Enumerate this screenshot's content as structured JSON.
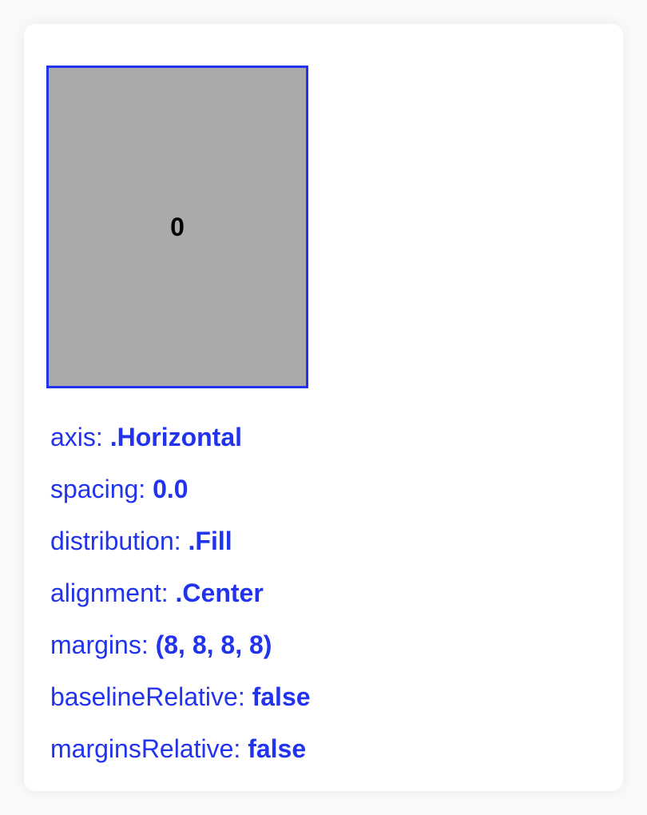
{
  "colors": {
    "accent": "#2233ee",
    "item_fill": "#aaaaaa",
    "background": "#ffffff"
  },
  "stack_view": {
    "items": [
      {
        "label": "0"
      }
    ]
  },
  "properties": [
    {
      "key": "axis:",
      "value": ".Horizontal"
    },
    {
      "key": "spacing:",
      "value": "0.0"
    },
    {
      "key": "distribution:",
      "value": ".Fill"
    },
    {
      "key": "alignment:",
      "value": ".Center"
    },
    {
      "key": "margins:",
      "value": "(8, 8, 8, 8)"
    },
    {
      "key": "baselineRelative:",
      "value": "false"
    },
    {
      "key": "marginsRelative:",
      "value": "false"
    }
  ]
}
